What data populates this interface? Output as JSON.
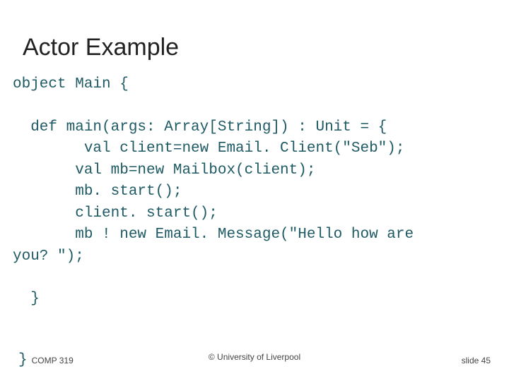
{
  "title": "Actor Example",
  "code": {
    "l1": "object Main {",
    "l2": "  def main(args: Array[String]) : Unit = {",
    "l3": "        val client=new Email. Client(\"Seb\");",
    "l4": "       val mb=new Mailbox(client);",
    "l5": "       mb. start();",
    "l6": "       client. start();",
    "l7": "       mb ! new Email. Message(\"Hello how are",
    "l8": "you? \");",
    "l9": "  }"
  },
  "footer": {
    "close_brace": "}",
    "left": "COMP 319",
    "center": "© University of Liverpool",
    "right": "slide  45"
  }
}
